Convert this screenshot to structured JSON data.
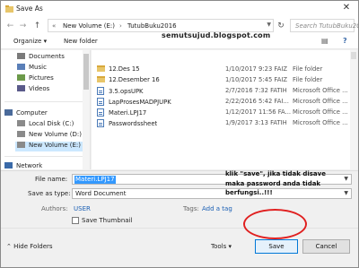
{
  "window": {
    "title": "Save As",
    "close_glyph": "✕"
  },
  "address_bar": {
    "back_glyph": "←",
    "forward_glyph": "→",
    "up_glyph": "↑",
    "chevron": "«",
    "segments": [
      "New Volume (E:)",
      "TutubBuku2016"
    ],
    "separator": "›",
    "search_placeholder": "Search TutubBuku2016"
  },
  "watermark": "semutsujud.blogspot.com",
  "toolbar": {
    "organize_label": "Organize ▾",
    "new_folder_label": "New folder"
  },
  "sidebar": {
    "items": [
      {
        "label": "Documents",
        "icon": "documents-icon",
        "color": "#7a7a7a"
      },
      {
        "label": "Music",
        "icon": "music-icon",
        "color": "#5a7fb8"
      },
      {
        "label": "Pictures",
        "icon": "pictures-icon",
        "color": "#6c9a4a"
      },
      {
        "label": "Videos",
        "icon": "videos-icon",
        "color": "#5a5a8a"
      },
      {
        "label": "Computer",
        "icon": "computer-icon",
        "color": "#4a6a9a"
      },
      {
        "label": "Local Disk (C:)",
        "icon": "drive-icon",
        "color": "#8a8a8a"
      },
      {
        "label": "New Volume (D:)",
        "icon": "drive-icon",
        "color": "#8a8a8a"
      },
      {
        "label": "New Volume (E:)",
        "icon": "drive-icon",
        "color": "#8a8a8a"
      },
      {
        "label": "Network",
        "icon": "network-icon",
        "color": "#3a6aa8"
      }
    ]
  },
  "files": [
    {
      "name": "12.Des 15",
      "date": "1/10/2017 9:23 FAIZ",
      "type": "File folder",
      "kind": "folder"
    },
    {
      "name": "12.Desember 16",
      "date": "1/10/2017 5:45 FAIZ",
      "type": "File folder",
      "kind": "folder"
    },
    {
      "name": "3.5.opsUPK",
      "date": "2/7/2016 7:32 FATIH",
      "type": "Microsoft Office ...",
      "kind": "doc"
    },
    {
      "name": "LapProsesMADPJUPK",
      "date": "2/22/2016 5:42 FAI...",
      "type": "Microsoft Office ...",
      "kind": "doc"
    },
    {
      "name": "Materi.LPJ17",
      "date": "1/12/2017 11:56 FA...",
      "type": "Microsoft Office ...",
      "kind": "doc"
    },
    {
      "name": "Passwordssheet",
      "date": "1/9/2017 3:13 FATIH",
      "type": "Microsoft Office ...",
      "kind": "doc"
    }
  ],
  "form": {
    "file_name_label": "File name:",
    "file_name_value": "Materi.LPJ17",
    "save_as_type_label": "Save as type:",
    "save_as_type_value": "Word Document",
    "authors_label": "Authors:",
    "authors_value": "USER",
    "tags_label": "Tags:",
    "tags_value": "Add a tag",
    "thumbnail_label": "Save Thumbnail"
  },
  "annotation": "klik \"save\", jika tidak disave maka password anda tidak berfungsi..!!!",
  "footer": {
    "hide_folders_label": "⌃  Hide Folders",
    "tools_label": "Tools  ▾",
    "save_label": "Save",
    "cancel_label": "Cancel"
  },
  "colors": {
    "accent": "#0078d7",
    "selection": "#3399ff",
    "highlight_ring": "#e02020"
  }
}
